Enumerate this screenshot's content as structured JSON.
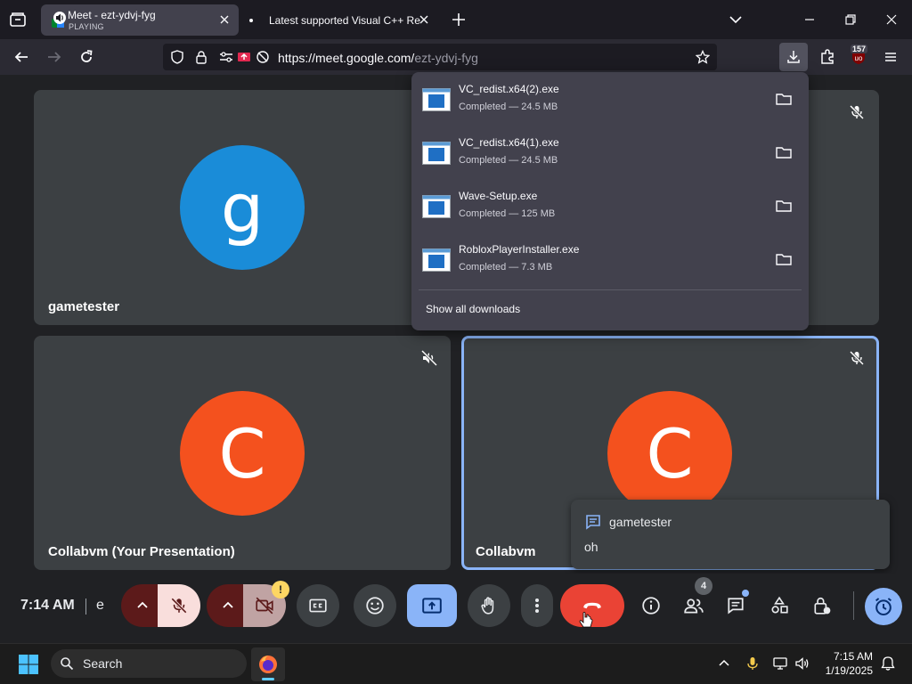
{
  "browser": {
    "tabs": [
      {
        "title": "Meet - ezt-ydvj-fyg",
        "subtitle": "PLAYING",
        "active": true
      },
      {
        "title": "Latest supported Visual C++ Re",
        "active": false
      }
    ],
    "url": {
      "domain": "https://meet.google.com/",
      "path": "ezt-ydvj-fyg"
    },
    "extension_badge": "157"
  },
  "downloads": {
    "items": [
      {
        "name": "VC_redist.x64(2).exe",
        "status": "Completed — 24.5 MB"
      },
      {
        "name": "VC_redist.x64(1).exe",
        "status": "Completed — 24.5 MB"
      },
      {
        "name": "Wave-Setup.exe",
        "status": "Completed — 125 MB"
      },
      {
        "name": "RobloxPlayerInstaller.exe",
        "status": "Completed — 7.3 MB"
      }
    ],
    "show_all": "Show all downloads"
  },
  "meet": {
    "tiles": [
      {
        "name": "gametester",
        "initial": "g",
        "color": "#1a8cd8"
      },
      {
        "name": "Collabvm (Your Presentation)",
        "initial": "C",
        "color": "#f4511e"
      },
      {
        "name": "Collabvm",
        "initial": "C",
        "color": "#f4511e"
      }
    ],
    "chat_popup": {
      "sender": "gametester",
      "message": "oh"
    },
    "time": "7:14 AM",
    "code_label": "e",
    "participant_count": "4",
    "camera_warning": "!",
    "colors": {
      "leave": "#ea4335",
      "present": "#8ab4f8",
      "mic_off_bg": "#f9dedc"
    }
  },
  "taskbar": {
    "search_placeholder": "Search",
    "time": "7:15 AM",
    "date": "1/19/2025"
  }
}
